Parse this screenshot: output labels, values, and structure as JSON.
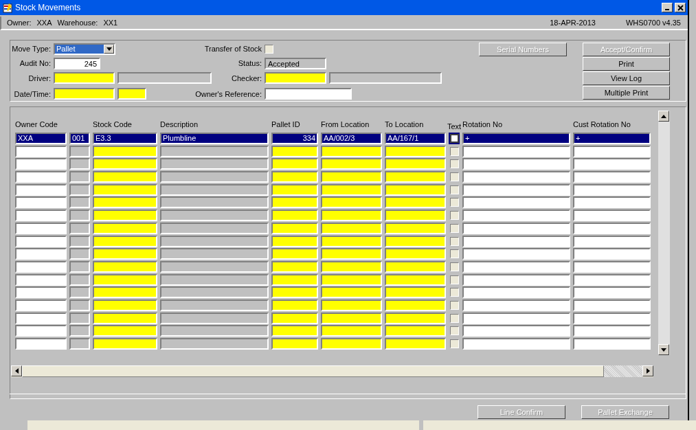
{
  "window": {
    "title": "Stock Movements"
  },
  "info_bar": {
    "owner_label": "Owner:",
    "owner": "XXA",
    "warehouse_label": "Warehouse:",
    "warehouse": "XX1",
    "date": "18-APR-2013",
    "version": "WHS0700  v4.35"
  },
  "form": {
    "move_type": {
      "label": "Move Type:",
      "value": "Pallet"
    },
    "audit_no": {
      "label": "Audit No:",
      "value": "245"
    },
    "driver": {
      "label": "Driver:",
      "fields": [
        {
          "kind": "required"
        },
        {
          "kind": "display"
        }
      ]
    },
    "date_time": {
      "label": "Date/Time:",
      "fields": [
        {
          "kind": "required"
        },
        {
          "kind": "required"
        }
      ]
    },
    "transfer_of_stock": {
      "label": "Transfer of Stock",
      "checked": false
    },
    "status": {
      "label": "Status:",
      "value": "Accepted"
    },
    "checker": {
      "label": "Checker:",
      "fields": [
        {
          "kind": "required"
        },
        {
          "kind": "display"
        }
      ]
    },
    "owners_reference": {
      "label": "Owner's Reference:"
    }
  },
  "side_button": {
    "label": "Serial Numbers",
    "disabled": true
  },
  "buttons": [
    {
      "label": "Accept/Confirm",
      "disabled": true
    },
    {
      "label": "Print",
      "disabled": false
    },
    {
      "label": "View Log",
      "disabled": false
    },
    {
      "label": "Multiple Print",
      "disabled": false
    }
  ],
  "table": {
    "columns": [
      {
        "header": "Owner Code",
        "kind": "input"
      },
      {
        "kind": "display"
      },
      {
        "header": "Stock Code",
        "kind": "required"
      },
      {
        "header": "Description",
        "kind": "display"
      },
      {
        "header": "Pallet ID",
        "kind": "numeric"
      },
      {
        "header": "From Location",
        "kind": "required"
      },
      {
        "header": "To Location",
        "kind": "required"
      },
      {
        "header": "Text",
        "kind": "checkbox"
      },
      {
        "header": "Rotation No",
        "kind": "input"
      },
      {
        "header": "Cust Rotation No",
        "kind": "input"
      }
    ],
    "rows": [
      {
        "selected": true,
        "text_checked": false,
        "cells": [
          "XXA",
          "001",
          "E3.3",
          "Plumbline",
          "334",
          "AA/002/3",
          "AA/167/1",
          "+",
          "+"
        ]
      },
      {
        "selected": false,
        "text_checked": false
      },
      {
        "selected": false,
        "text_checked": false
      },
      {
        "selected": false,
        "text_checked": false
      },
      {
        "selected": false,
        "text_checked": false
      },
      {
        "selected": false,
        "text_checked": false
      },
      {
        "selected": false,
        "text_checked": false
      },
      {
        "selected": false,
        "text_checked": false
      },
      {
        "selected": false,
        "text_checked": false
      },
      {
        "selected": false,
        "text_checked": false
      },
      {
        "selected": false,
        "text_checked": false
      },
      {
        "selected": false,
        "text_checked": false
      },
      {
        "selected": false,
        "text_checked": false
      },
      {
        "selected": false,
        "text_checked": false
      },
      {
        "selected": false,
        "text_checked": false
      },
      {
        "selected": false,
        "text_checked": false
      },
      {
        "selected": false,
        "text_checked": false
      }
    ]
  },
  "footer_buttons": [
    {
      "label": "Line Confirm",
      "disabled": true
    },
    {
      "label": "Pallet Exchange",
      "disabled": true
    }
  ]
}
